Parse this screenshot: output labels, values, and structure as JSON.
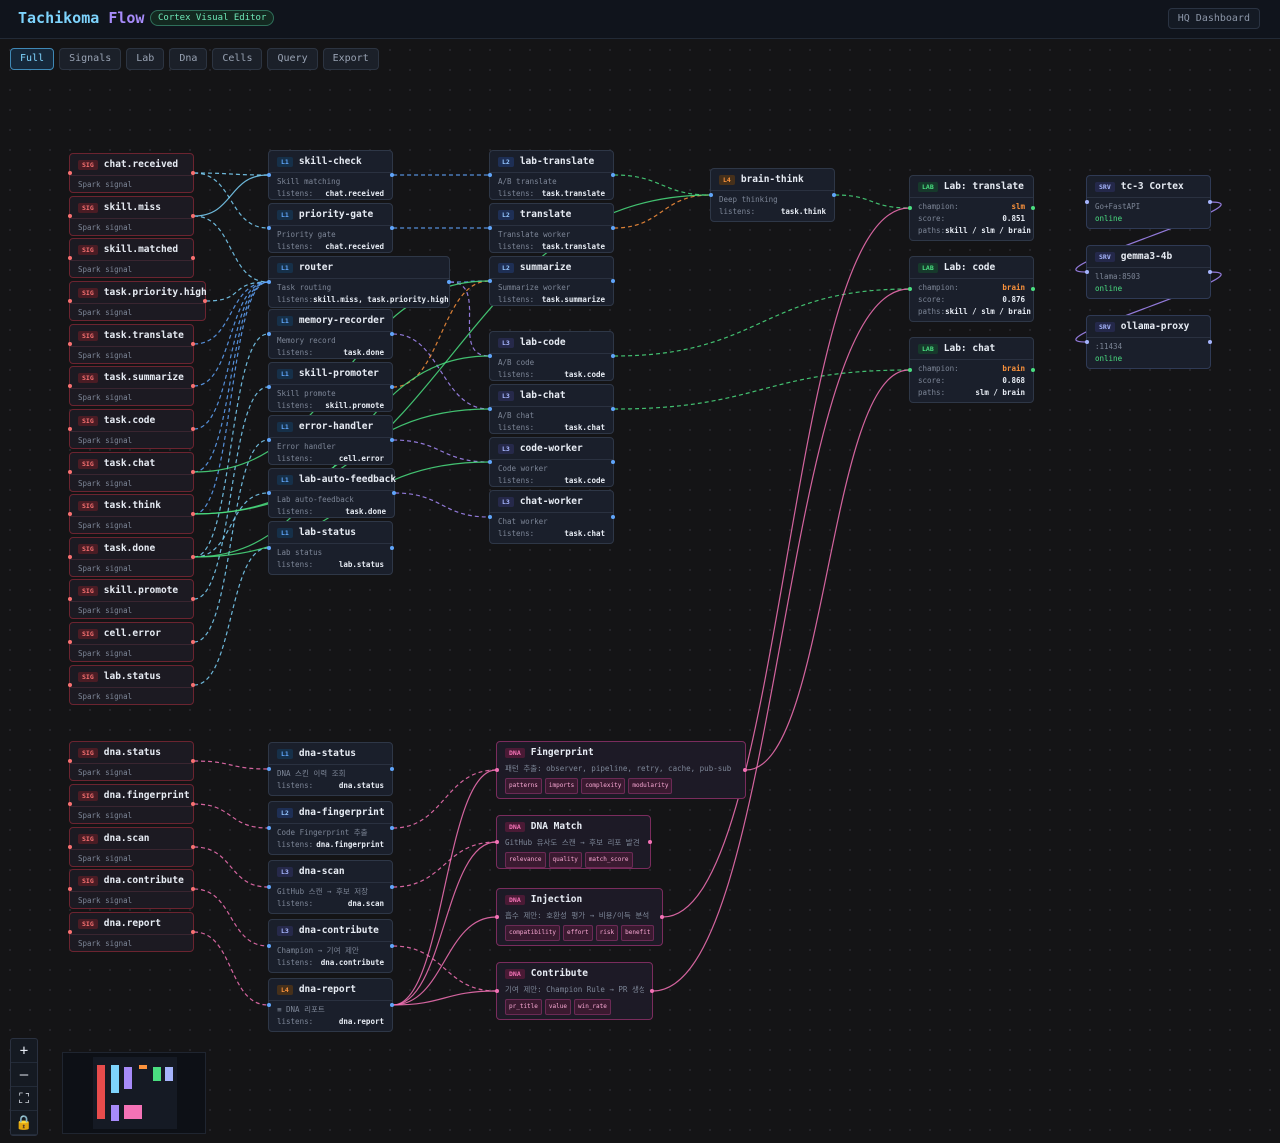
{
  "header": {
    "brand_a": "Tachikoma",
    "brand_b": "Flow",
    "badge": "Cortex Visual Editor",
    "hq_button": "HQ Dashboard"
  },
  "tabs": [
    {
      "label": "Full",
      "active": true
    },
    {
      "label": "Signals"
    },
    {
      "label": "Lab"
    },
    {
      "label": "Dna"
    },
    {
      "label": "Cells"
    },
    {
      "label": "Query"
    },
    {
      "label": "Export"
    }
  ],
  "colors": {
    "sig": "#f87171",
    "l1": "#60a5fa",
    "cyan": "#7dd3fc",
    "purple": "#a78bfa",
    "green": "#4ade80",
    "orange": "#fb923c",
    "pink": "#f472b6"
  },
  "signals": [
    {
      "id": "chat_received",
      "name": "chat.received",
      "sub": "Spark signal"
    },
    {
      "id": "skill_miss",
      "name": "skill.miss",
      "sub": "Spark signal"
    },
    {
      "id": "skill_matched",
      "name": "skill.matched",
      "sub": "Spark signal"
    },
    {
      "id": "task_priority_high",
      "name": "task.priority.high",
      "sub": "Spark signal"
    },
    {
      "id": "task_translate",
      "name": "task.translate",
      "sub": "Spark signal"
    },
    {
      "id": "task_summarize",
      "name": "task.summarize",
      "sub": "Spark signal"
    },
    {
      "id": "task_code",
      "name": "task.code",
      "sub": "Spark signal"
    },
    {
      "id": "task_chat",
      "name": "task.chat",
      "sub": "Spark signal"
    },
    {
      "id": "task_think",
      "name": "task.think",
      "sub": "Spark signal"
    },
    {
      "id": "task_done",
      "name": "task.done",
      "sub": "Spark signal"
    },
    {
      "id": "skill_promote",
      "name": "skill.promote",
      "sub": "Spark signal"
    },
    {
      "id": "cell_error",
      "name": "cell.error",
      "sub": "Spark signal"
    },
    {
      "id": "lab_status",
      "name": "lab.status",
      "sub": "Spark signal"
    },
    {
      "id": "dna_status",
      "name": "dna.status",
      "sub": "Spark signal"
    },
    {
      "id": "dna_fingerprint",
      "name": "dna.fingerprint",
      "sub": "Spark signal"
    },
    {
      "id": "dna_scan",
      "name": "dna.scan",
      "sub": "Spark signal"
    },
    {
      "id": "dna_contribute",
      "name": "dna.contribute",
      "sub": "Spark signal"
    },
    {
      "id": "dna_report",
      "name": "dna.report",
      "sub": "Spark signal"
    }
  ],
  "cells": [
    {
      "id": "skill_check",
      "level": "L1",
      "name": "skill-check",
      "desc": "Skill matching",
      "listens": "chat.received"
    },
    {
      "id": "priority_gate",
      "level": "L1",
      "name": "priority-gate",
      "desc": "Priority gate",
      "listens": "chat.received"
    },
    {
      "id": "router",
      "level": "L1",
      "name": "router",
      "desc": "Task routing",
      "listens": "skill.miss, task.priority.high"
    },
    {
      "id": "memory_recorder",
      "level": "L1",
      "name": "memory-recorder",
      "desc": "Memory record",
      "listens": "task.done"
    },
    {
      "id": "skill_promoter",
      "level": "L1",
      "name": "skill-promoter",
      "desc": "Skill promote",
      "listens": "skill.promote"
    },
    {
      "id": "error_handler",
      "level": "L1",
      "name": "error-handler",
      "desc": "Error handler",
      "listens": "cell.error"
    },
    {
      "id": "lab_auto_feedback",
      "level": "L1",
      "name": "lab-auto-feedback",
      "desc": "Lab auto-feedback",
      "listens": "task.done"
    },
    {
      "id": "lab_status_cell",
      "level": "L1",
      "name": "lab-status",
      "desc": "Lab status",
      "listens": "lab.status"
    },
    {
      "id": "lab_translate",
      "level": "L2",
      "name": "lab-translate",
      "desc": "A/B translate",
      "listens": "task.translate"
    },
    {
      "id": "translate",
      "level": "L2",
      "name": "translate",
      "desc": "Translate worker",
      "listens": "task.translate"
    },
    {
      "id": "summarize",
      "level": "L2",
      "name": "summarize",
      "desc": "Summarize worker",
      "listens": "task.summarize"
    },
    {
      "id": "lab_code",
      "level": "L3",
      "name": "lab-code",
      "desc": "A/B code",
      "listens": "task.code"
    },
    {
      "id": "lab_chat",
      "level": "L3",
      "name": "lab-chat",
      "desc": "A/B chat",
      "listens": "task.chat"
    },
    {
      "id": "code_worker",
      "level": "L3",
      "name": "code-worker",
      "desc": "Code worker",
      "listens": "task.code"
    },
    {
      "id": "chat_worker",
      "level": "L3",
      "name": "chat-worker",
      "desc": "Chat worker",
      "listens": "task.chat"
    },
    {
      "id": "brain_think",
      "level": "L4",
      "name": "brain-think",
      "desc": "Deep thinking",
      "listens": "task.think"
    },
    {
      "id": "dna_status_cell",
      "level": "L1",
      "name": "dna-status",
      "desc": "DNA 스킨 이력 조회",
      "listens": "dna.status"
    },
    {
      "id": "dna_fingerprint_cell",
      "level": "L2",
      "name": "dna-fingerprint",
      "desc": "Code Fingerprint 추출",
      "listens": "dna.fingerprint"
    },
    {
      "id": "dna_scan_cell",
      "level": "L3",
      "name": "dna-scan",
      "desc": "GitHub 스캔 → 후보 저장",
      "listens": "dna.scan"
    },
    {
      "id": "dna_contribute_cell",
      "level": "L3",
      "name": "dna-contribute",
      "desc": "Champion → 기여 제안",
      "listens": "dna.contribute"
    },
    {
      "id": "dna_report_cell",
      "level": "L4",
      "name": "dna-report",
      "desc": "≡ DNA 리포트",
      "listens": "dna.report"
    }
  ],
  "labs": [
    {
      "id": "lab_translate_res",
      "name": "Lab: translate",
      "champion": "slm",
      "score": "0.851",
      "paths": "skill / slm / brain"
    },
    {
      "id": "lab_code_res",
      "name": "Lab: code",
      "champion": "brain",
      "score": "0.876",
      "paths": "skill / slm / brain"
    },
    {
      "id": "lab_chat_res",
      "name": "Lab: chat",
      "champion": "brain",
      "score": "0.868",
      "paths": "slm / brain"
    }
  ],
  "lab_labels": {
    "champion": "champion:",
    "score": "score:",
    "paths": "paths:",
    "listens": "listens:"
  },
  "servers": [
    {
      "id": "tc3",
      "name": "tc-3 Cortex",
      "detail": "Go+FastAPI",
      "status": "online"
    },
    {
      "id": "gemma",
      "name": "gemma3-4b",
      "detail": "llama:8503",
      "status": "online"
    },
    {
      "id": "ollama",
      "name": "ollama-proxy",
      "detail": ":11434",
      "status": "online"
    }
  ],
  "dna_nodes": [
    {
      "id": "fingerprint",
      "name": "Fingerprint",
      "desc": "패턴 추출: observer, pipeline, retry, cache, pub-sub ...",
      "chips": [
        "patterns",
        "imports",
        "complexity",
        "modularity"
      ]
    },
    {
      "id": "dna_match",
      "name": "DNA Match",
      "desc": "GitHub 유사도 스캔 → 후보 리포 발견",
      "chips": [
        "relevance",
        "quality",
        "match_score"
      ]
    },
    {
      "id": "injection",
      "name": "Injection",
      "desc": "흡수 제안: 호환성 평가 → 비용/이득 분석",
      "chips": [
        "compatibility",
        "effort",
        "risk",
        "benefit"
      ]
    },
    {
      "id": "contribute",
      "name": "Contribute",
      "desc": "기여 제안: Champion Rule → PR 생성",
      "chips": [
        "pr_title",
        "value",
        "win_rate"
      ]
    }
  ],
  "zoom_controls": [
    "+",
    "—",
    "⛶",
    "🔒"
  ]
}
